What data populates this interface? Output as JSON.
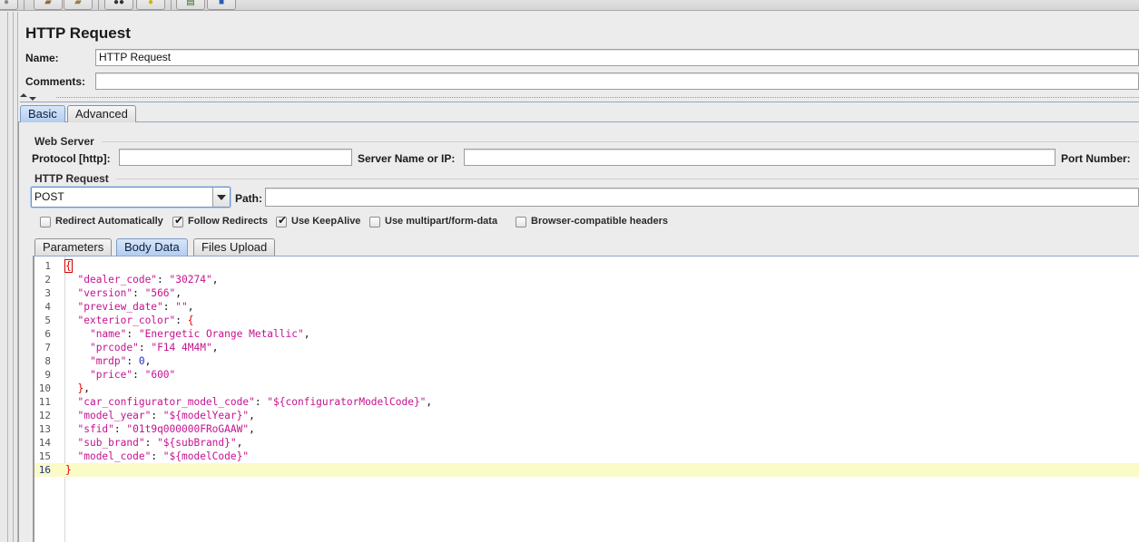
{
  "toolbar": {
    "buttons": [
      "open-icon",
      "save-icon",
      "binoculars-icon",
      "lightbulb-icon",
      "function-helper-icon",
      "help-icon"
    ]
  },
  "header": {
    "title": "HTTP Request",
    "name_label": "Name:",
    "name_value": "HTTP Request",
    "comments_label": "Comments:",
    "comments_value": ""
  },
  "tabs": [
    {
      "label": "Basic",
      "active": true
    },
    {
      "label": "Advanced",
      "active": false
    }
  ],
  "web_server": {
    "title": "Web Server",
    "protocol_label": "Protocol [http]:",
    "protocol_value": "",
    "server_label": "Server Name or IP:",
    "server_value": "",
    "port_label": "Port Number:"
  },
  "http_request": {
    "title": "HTTP Request",
    "method": "POST",
    "path_label": "Path:",
    "path_value": ""
  },
  "options": [
    {
      "label": "Redirect Automatically",
      "checked": false
    },
    {
      "label": "Follow Redirects",
      "checked": true
    },
    {
      "label": "Use KeepAlive",
      "checked": true
    },
    {
      "label": "Use multipart/form-data",
      "checked": false
    },
    {
      "label": "Browser-compatible headers",
      "checked": false
    }
  ],
  "subtabs": [
    {
      "label": "Parameters",
      "active": false
    },
    {
      "label": "Body Data",
      "active": true
    },
    {
      "label": "Files Upload",
      "active": false
    }
  ],
  "body_lines": [
    "{",
    "  \"dealer_code\": \"30274\",",
    "  \"version\": \"566\",",
    "  \"preview_date\": \"\",",
    "  \"exterior_color\": {",
    "    \"name\": \"Energetic Orange Metallic\",",
    "    \"prcode\": \"F14 4M4M\",",
    "    \"mrdp\": 0,",
    "    \"price\": \"600\"",
    "  },",
    "  \"car_configurator_model_code\": \"${configuratorModelCode}\",",
    "  \"model_year\": \"${modelYear}\",",
    "  \"sfid\": \"01t9q000000FRoGAAW\",",
    "  \"sub_brand\": \"${subBrand}\",",
    "  \"model_code\": \"${modelCode}\"",
    "}"
  ],
  "current_line": 16,
  "colors": {
    "json_key": "#c4128e",
    "json_number": "#1a2fbf",
    "json_brace": "#e40000",
    "current_line_bg": "#fbfbc8",
    "tab_active": "#b3cdef"
  }
}
